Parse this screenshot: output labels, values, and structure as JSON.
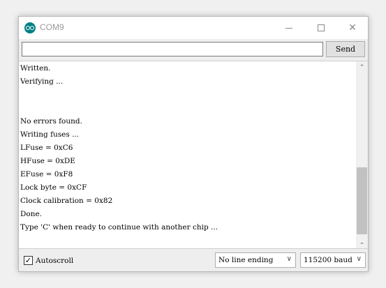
{
  "window": {
    "title": "COM9",
    "app_icon": "arduino-icon"
  },
  "titlebar": {
    "minimize_icon": "minimize-icon",
    "maximize_icon": "maximize-icon",
    "close_icon": "close-icon",
    "close_glyph": "✕"
  },
  "send": {
    "input_value": "",
    "button_label": "Send"
  },
  "output": {
    "lines": [
      "Written.",
      "Verifying ...",
      "",
      "",
      "No errors found.",
      "Writing fuses ...",
      "LFuse = 0xC6",
      "HFuse = 0xDE",
      "EFuse = 0xF8",
      "Lock byte = 0xCF",
      "Clock calibration = 0x82",
      "Done.",
      "Type 'C' when ready to continue with another chip ..."
    ],
    "scroll": {
      "up_glyph": "⌃",
      "down_glyph": "⌄"
    }
  },
  "footer": {
    "autoscroll_label": "Autoscroll",
    "autoscroll_checked": true,
    "check_glyph": "✓",
    "line_ending_selected": "No line ending",
    "baud_selected": "115200 baud",
    "dropdown_glyph": "∨"
  },
  "colors": {
    "arduino_teal": "#008184",
    "title_text": "#999999"
  }
}
